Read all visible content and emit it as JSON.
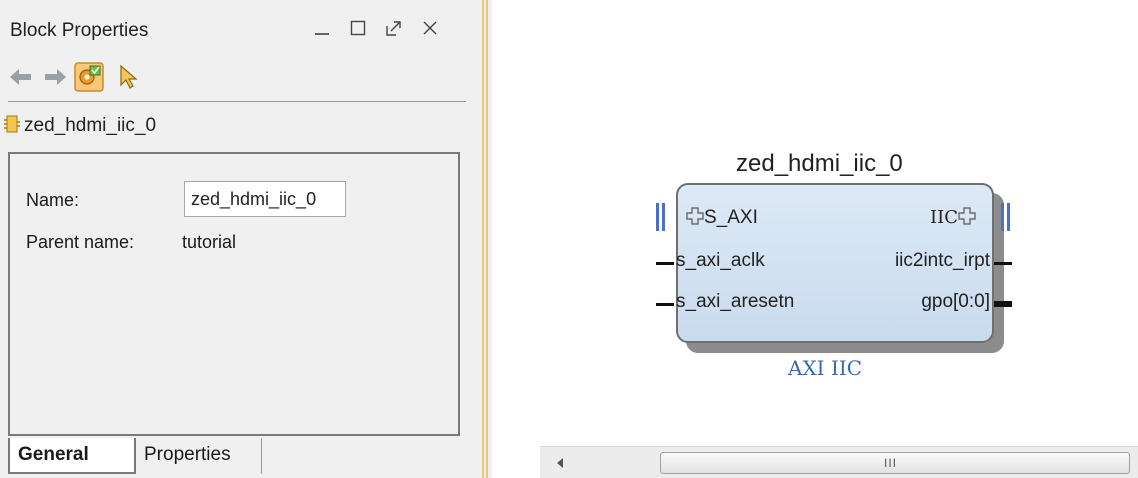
{
  "panel": {
    "title": "Block Properties",
    "window_controls": [
      "minimize-icon",
      "maximize-icon",
      "float-icon",
      "close-icon"
    ],
    "toolbar_icons": [
      "back-arrow-icon",
      "forward-arrow-icon",
      "auto-update-icon",
      "select-pointer-icon"
    ],
    "object_name": "zed_hdmi_iic_0",
    "fields": {
      "name_label": "Name:",
      "name_value": "zed_hdmi_iic_0",
      "parent_label": "Parent name:",
      "parent_value": "tutorial"
    },
    "tabs": [
      {
        "label": "General",
        "active": true
      },
      {
        "label": "Properties",
        "active": false
      }
    ]
  },
  "diagram": {
    "block_name": "zed_hdmi_iic_0",
    "block_type": "AXI IIC",
    "left_ports": [
      {
        "label": "S_AXI",
        "kind": "bus"
      },
      {
        "label": "s_axi_aclk",
        "kind": "pin"
      },
      {
        "label": "s_axi_aresetn",
        "kind": "pin"
      }
    ],
    "right_ports": [
      {
        "label": "IIC",
        "kind": "bus"
      },
      {
        "label": "iic2intc_irpt",
        "kind": "pin"
      },
      {
        "label": "gpo[0:0]",
        "kind": "bus-pin"
      }
    ],
    "bus_icon": "plus-bus-icon"
  },
  "colors": {
    "block_fill": "#c9dbee",
    "bus_connector": "#4a6fd1",
    "block_type_text": "#3a6aa8",
    "splitter": "#e8c87a"
  },
  "scrollbar": {
    "grip": "III"
  }
}
